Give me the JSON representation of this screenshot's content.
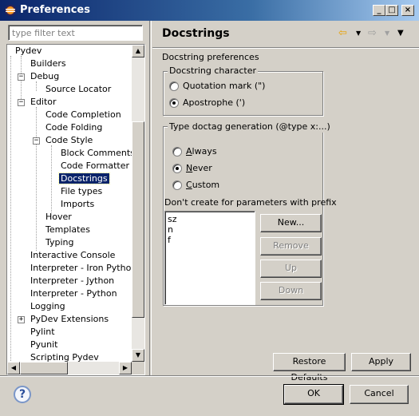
{
  "window": {
    "title": "Preferences",
    "minimize": "_",
    "maximize": "□",
    "close": "×"
  },
  "filter": {
    "placeholder": "type filter text",
    "value": ""
  },
  "tree": {
    "items": [
      {
        "label": "Pydev"
      },
      {
        "label": "Builders"
      },
      {
        "label": "Debug"
      },
      {
        "label": "Source Locator"
      },
      {
        "label": "Editor"
      },
      {
        "label": "Code Completion"
      },
      {
        "label": "Code Folding"
      },
      {
        "label": "Code Style"
      },
      {
        "label": "Block Comments"
      },
      {
        "label": "Code Formatter"
      },
      {
        "label": "Docstrings"
      },
      {
        "label": "File types"
      },
      {
        "label": "Imports"
      },
      {
        "label": "Hover"
      },
      {
        "label": "Templates"
      },
      {
        "label": "Typing"
      },
      {
        "label": "Interactive Console"
      },
      {
        "label": "Interpreter - Iron Python"
      },
      {
        "label": "Interpreter - Jython"
      },
      {
        "label": "Interpreter - Python"
      },
      {
        "label": "Logging"
      },
      {
        "label": "PyDev Extensions"
      },
      {
        "label": "Pylint"
      },
      {
        "label": "Pyunit"
      },
      {
        "label": "Scripting Pydev"
      }
    ],
    "selected": "Docstrings"
  },
  "page": {
    "title": "Docstrings",
    "description": "Docstring preferences",
    "docstring_group": {
      "title": "Docstring character",
      "options": [
        "Quotation mark (\")",
        "Apostrophe (')"
      ],
      "selected": "Apostrophe (')"
    },
    "doctag_group": {
      "title": "Type doctag generation (@type x:...)",
      "options": [
        "Always",
        "Never",
        "Custom"
      ],
      "selected": "Never",
      "prefix_label": "Don't create for parameters with prefix",
      "prefixes": [
        "sz",
        "n",
        "f"
      ],
      "buttons": {
        "new": "New...",
        "remove": "Remove",
        "up": "Up",
        "down": "Down"
      }
    }
  },
  "buttons": {
    "restore_defaults": "Restore Defaults",
    "apply": "Apply",
    "ok": "OK",
    "cancel": "Cancel"
  },
  "help_icon": "?",
  "icons": {
    "back": "back-arrow-icon",
    "forward": "forward-arrow-icon",
    "menu": "view-menu-icon"
  }
}
